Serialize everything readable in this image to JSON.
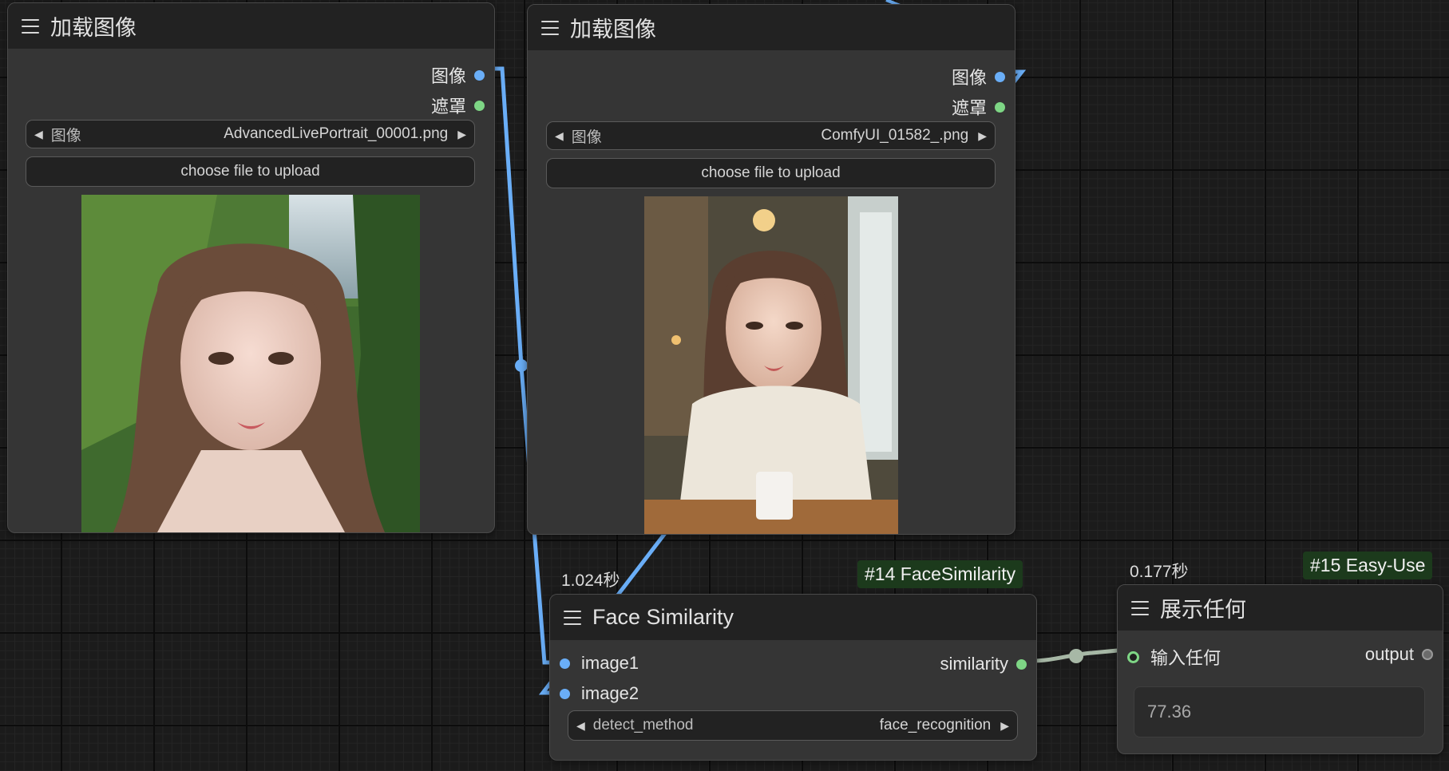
{
  "colors": {
    "image_link": "#6aaef7",
    "mask_slot": "#7ed685",
    "float_link": "#a7b8a6",
    "badge_bg": "#1c3a1c"
  },
  "node_a": {
    "title": "加载图像",
    "outputs": [
      "图像",
      "遮罩"
    ],
    "image_widget": {
      "label": "图像",
      "value": "AdvancedLivePortrait_00001.png"
    },
    "upload_label": "choose file to upload",
    "preview": "portrait-waterfall"
  },
  "node_b": {
    "title": "加载图像",
    "outputs": [
      "图像",
      "遮罩"
    ],
    "image_widget": {
      "label": "图像",
      "value": "ComfyUI_01582_.png"
    },
    "upload_label": "choose file to upload",
    "preview": "portrait-cafe"
  },
  "face_similarity": {
    "badge": "#14 FaceSimilarity",
    "time": "1.024秒",
    "title": "Face Similarity",
    "inputs": [
      "image1",
      "image2"
    ],
    "output": "similarity",
    "detect_widget": {
      "label": "detect_method",
      "value": "face_recognition"
    }
  },
  "show_any": {
    "badge": "#15 Easy-Use",
    "time": "0.177秒",
    "title": "展示任何",
    "input": "输入任何",
    "output": "output",
    "value": "77.36"
  },
  "icons": {
    "menu": "hamburger-menu-icon",
    "arrow_left": "◀",
    "arrow_right": "▶"
  }
}
